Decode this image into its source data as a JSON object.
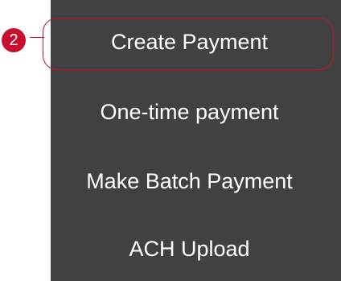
{
  "menu": {
    "items": [
      {
        "label": "Create Payment"
      },
      {
        "label": "One-time payment"
      },
      {
        "label": "Make Batch Payment"
      },
      {
        "label": "ACH Upload"
      }
    ]
  },
  "callout": {
    "number": "2",
    "color": "#c8102e"
  },
  "colors": {
    "panel_background": "#414141",
    "text": "#ffffff"
  }
}
